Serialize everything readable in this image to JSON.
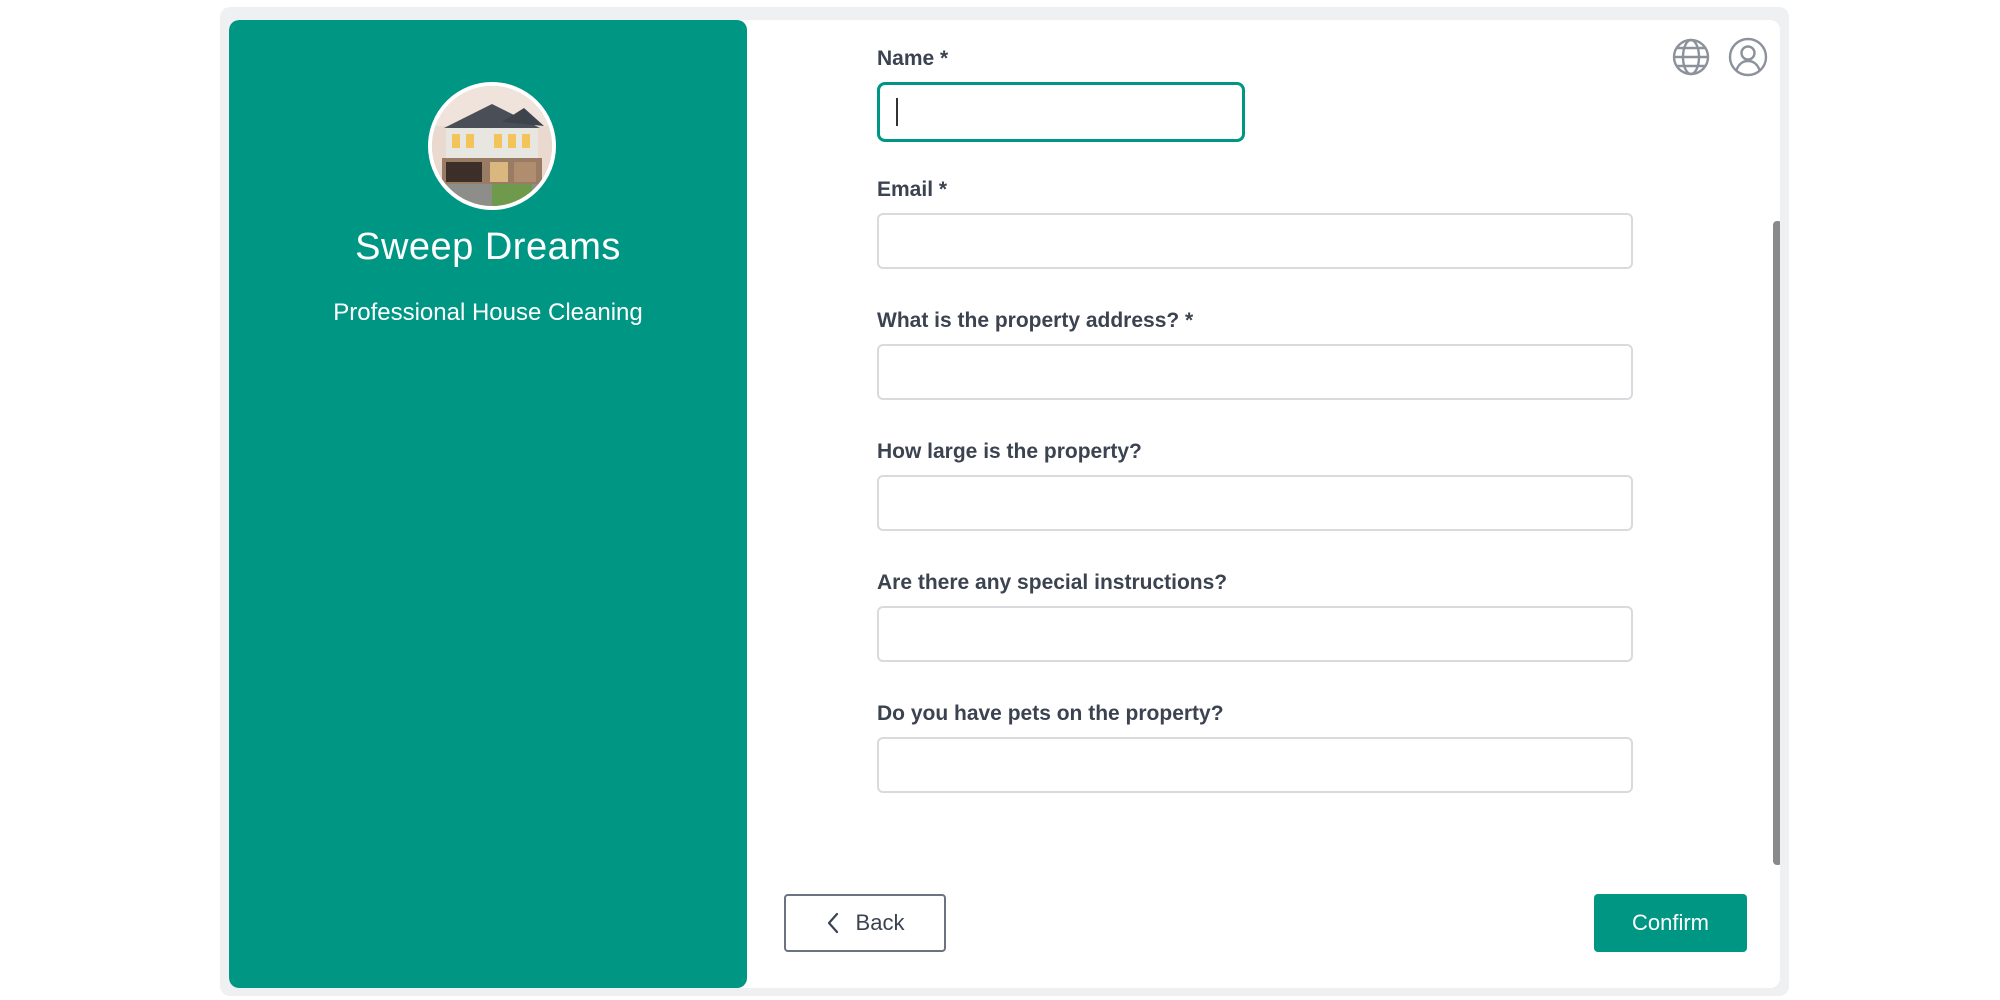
{
  "business": {
    "name": "Sweep Dreams",
    "tagline": "Professional House Cleaning",
    "avatar_icon": "house-photo"
  },
  "header": {
    "language_icon": "globe-icon",
    "account_icon": "user-circle-icon"
  },
  "form": {
    "fields": [
      {
        "label": "Name *",
        "value": ""
      },
      {
        "label": "Email *",
        "value": ""
      },
      {
        "label": "What is the property address? *",
        "value": ""
      },
      {
        "label": "How large is the property?",
        "value": ""
      },
      {
        "label": "Are there any special instructions?",
        "value": ""
      },
      {
        "label": "Do you have pets on the property?",
        "value": ""
      }
    ]
  },
  "actions": {
    "back_label": "Back",
    "confirm_label": "Confirm"
  },
  "colors": {
    "accent": "#009684",
    "label_text": "#3c4350",
    "input_border": "#d8dadd"
  }
}
